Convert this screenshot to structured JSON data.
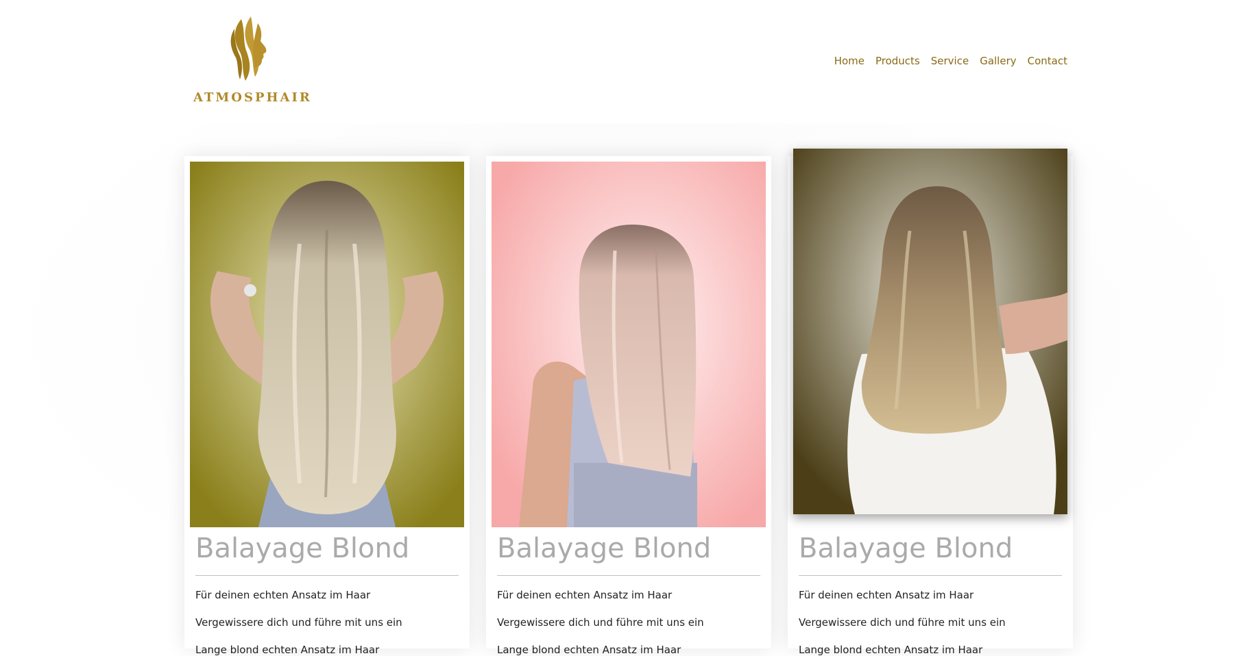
{
  "brand": {
    "name": "ATMOSPHAIR",
    "logo_icon": "woman-profile-hair-icon",
    "color": "#b08a2a"
  },
  "nav": {
    "items": [
      {
        "label": "Home"
      },
      {
        "label": "Products"
      },
      {
        "label": "Service"
      },
      {
        "label": "Gallery"
      },
      {
        "label": "Contact"
      }
    ],
    "color": "#8a6a16"
  },
  "cards": [
    {
      "title": "Balayage Blond",
      "lines": [
        "Für deinen echten Ansatz im Haar",
        "Vergewissere dich und führe mit uns ein",
        "Lange blond echten Ansatz im Haar"
      ],
      "photo": "blonde-long-wavy-hair-photo",
      "bg": "#8a7f1a"
    },
    {
      "title": "Balayage Blond",
      "lines": [
        "Für deinen echten Ansatz im Haar",
        "Vergewissere dich und führe mit uns ein",
        "Lange blond echten Ansatz im Haar"
      ],
      "photo": "rose-blonde-straight-hair-photo",
      "bg": "#f7a8a8"
    },
    {
      "title": "Balayage Blond",
      "lines": [
        "Für deinen echten Ansatz im Haar",
        "Vergewissere dich und führe mit uns ein",
        "Lange blond echten Ansatz im Haar"
      ],
      "photo": "bronde-medium-wavy-hair-photo",
      "bg": "#4c3f18"
    }
  ]
}
